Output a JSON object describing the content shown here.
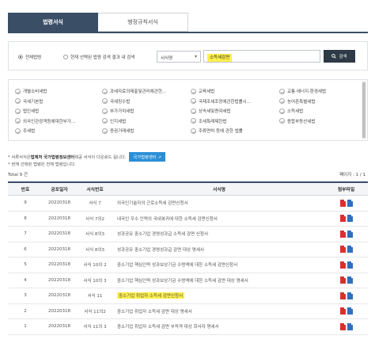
{
  "tabs": [
    {
      "label": "법령서식"
    },
    {
      "label": "행정규칙서식"
    }
  ],
  "search": {
    "radio_all": "전체법령",
    "radio_current": "현재 선택된 법령 검색 결과 내 검색",
    "select_value": "서식명",
    "query": "소득세감면",
    "button_label": "검색"
  },
  "categories": [
    "개별소비세법",
    "과세자료의제출및관리에관한...",
    "교육세법",
    "교통·에너지·환경세법",
    "국세기본법",
    "국세징수법",
    "국제조세조정에관한법률시...",
    "농어촌특별세법",
    "법인세법",
    "부가가치세법",
    "상속세및증여세법",
    "소득세법",
    "외국인관광객등에대한부가...",
    "인지세법",
    "조세특례제한법",
    "종합부동산세법",
    "주세법",
    "증권거래세법",
    "주류면허 등에 관한 법률",
    ""
  ],
  "notices": {
    "line1_prefix": "* 서류서식은 ",
    "line1_bold": "법제처 국가법령정보센터",
    "line1_suffix": " 제공 서식이 다운로드 됩니다.",
    "line1_button": "국가법령센터",
    "line2": "* 현재 선택된 법령은 전체 법령입니다."
  },
  "total": "Total 9 건",
  "page": "페이지 : 1 / 1",
  "table": {
    "headers": [
      "번호",
      "공포일자",
      "서식번호",
      "서식명",
      "첨부파일"
    ],
    "rows": [
      {
        "no": "9",
        "date": "20220318",
        "form_no": "서식 7",
        "name": "외국인기술자의 근로소득세 감면신청서"
      },
      {
        "no": "8",
        "date": "20220318",
        "form_no": "서식 7의2",
        "name": "내국인 우수 인력의 국내복귀에 대한 소득세 감면신청서"
      },
      {
        "no": "7",
        "date": "20220318",
        "form_no": "서식 8의3",
        "name": "성과공유 중소기업 경영성과급 소득세 감면 신청서"
      },
      {
        "no": "6",
        "date": "20220318",
        "form_no": "서식 8의3",
        "name": "성과공유 중소기업 경영성과급 감면 대상 명세서"
      },
      {
        "no": "5",
        "date": "20220318",
        "form_no": "서식 10의 2",
        "name": "중소기업 핵심인력 성과보상기금 수령액에 대한 소득세 감면신청서"
      },
      {
        "no": "4",
        "date": "20220318",
        "form_no": "서식 10의 3",
        "name": "중소기업 핵심인력 성과보상기금 수령액에 대한 소득세 감면 대상 명세서"
      },
      {
        "no": "3",
        "date": "20220318",
        "form_no": "서식 11",
        "name": "중소기업 취업자 소득세 감면신청서"
      },
      {
        "no": "2",
        "date": "20220318",
        "form_no": "서식 11의2",
        "name": "중소기업 취업자 소득세 감면 대상 명세서"
      },
      {
        "no": "1",
        "date": "20220318",
        "form_no": "서식 11의 3",
        "name": "중소기업 취업자 소득세 감면 부적격 대상 회사자 명세서"
      }
    ]
  },
  "colors": {
    "accent": "#3a4f66",
    "highlight": "#fff04a",
    "pdf": "#d9302f",
    "hwp": "#2f6fbf",
    "link_button": "#2b8fd6"
  }
}
